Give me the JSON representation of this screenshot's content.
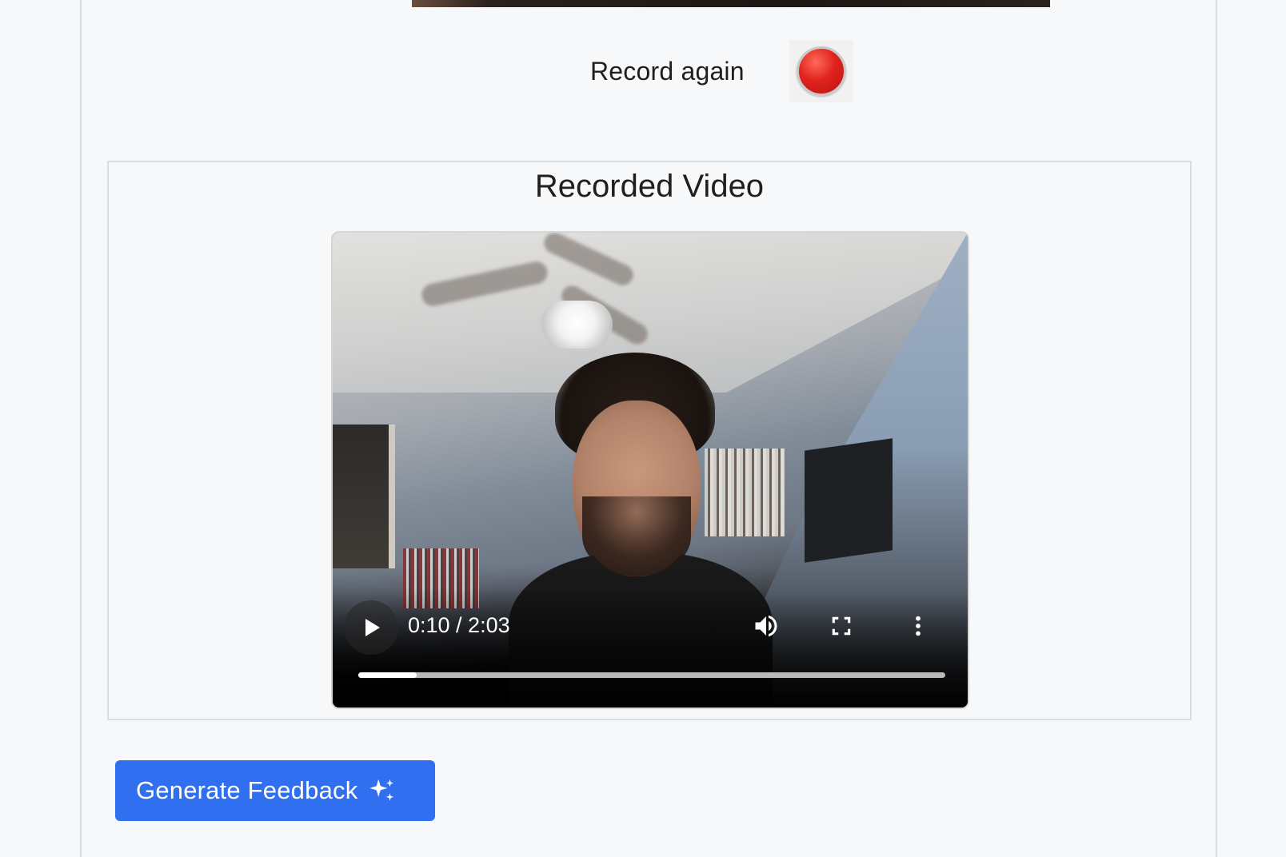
{
  "record": {
    "label": "Record again",
    "button_color": "#e0231c"
  },
  "recorded_video": {
    "title": "Recorded Video",
    "player": {
      "current_time": "0:10",
      "duration": "2:03",
      "time_text": "0:10 / 2:03",
      "progress_fraction": 0.1,
      "icons": [
        "play-icon",
        "volume-icon",
        "fullscreen-icon",
        "more-options-icon"
      ]
    }
  },
  "actions": {
    "generate_label": "Generate Feedback",
    "generate_icon": "sparkle-icon",
    "accent_color": "#2f6ff0"
  }
}
